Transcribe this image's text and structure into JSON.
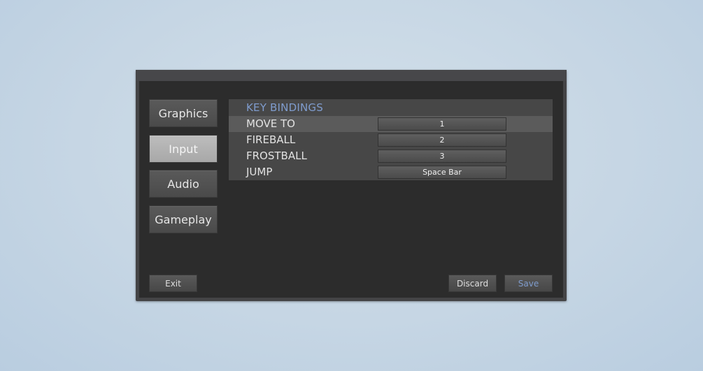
{
  "tabs": [
    {
      "label": "Graphics",
      "active": false
    },
    {
      "label": "Input",
      "active": true
    },
    {
      "label": "Audio",
      "active": false
    },
    {
      "label": "Gameplay",
      "active": false
    }
  ],
  "key_bindings": {
    "header": "KEY BINDINGS",
    "rows": [
      {
        "action": "MOVE TO",
        "key": "1",
        "highlighted": true
      },
      {
        "action": "FIREBALL",
        "key": "2",
        "highlighted": false
      },
      {
        "action": "FROSTBALL",
        "key": "3",
        "highlighted": false
      },
      {
        "action": "JUMP",
        "key": "Space Bar",
        "highlighted": false
      }
    ]
  },
  "footer": {
    "exit_label": "Exit",
    "discard_label": "Discard",
    "save_label": "Save"
  },
  "colors": {
    "accent": "#7f9ccd",
    "panel_bg": "#2c2c2c",
    "active_tab": "#b5b5b5"
  }
}
